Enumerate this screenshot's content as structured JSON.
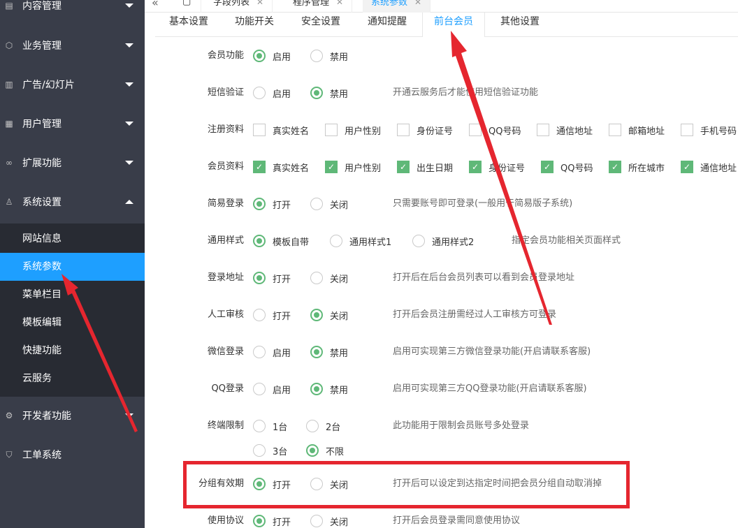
{
  "sidebar": {
    "items": [
      {
        "label": "内容管理",
        "icon": "content-icon"
      },
      {
        "label": "业务管理",
        "icon": "cube-icon"
      },
      {
        "label": "广告/幻灯片",
        "icon": "slides-icon"
      },
      {
        "label": "用户管理",
        "icon": "grid-icon"
      },
      {
        "label": "扩展功能",
        "icon": "infinity-icon"
      },
      {
        "label": "系统设置",
        "icon": "user-settings-icon"
      },
      {
        "label": "开发者功能",
        "icon": "gear-icon"
      },
      {
        "label": "工单系统",
        "icon": "shield-icon"
      }
    ],
    "submenu": [
      "网站信息",
      "系统参数",
      "菜单栏目",
      "模板编辑",
      "快捷功能",
      "云服务"
    ]
  },
  "top_tabs": [
    {
      "label": "字段列表"
    },
    {
      "label": "程序管理"
    },
    {
      "label": "系统参数"
    }
  ],
  "setting_tabs": [
    "基本设置",
    "功能开关",
    "安全设置",
    "通知提醒",
    "前台会员",
    "其他设置"
  ],
  "form": {
    "member_function": {
      "label": "会员功能",
      "options": [
        "启用",
        "禁用"
      ]
    },
    "sms_verify": {
      "label": "短信验证",
      "options": [
        "启用",
        "禁用"
      ],
      "tip": "开通云服务后才能使用短信验证功能"
    },
    "register_info": {
      "label": "注册资料",
      "options": [
        "真实姓名",
        "用户性别",
        "身份证号",
        "QQ号码",
        "通信地址",
        "邮箱地址",
        "手机号码"
      ]
    },
    "member_info": {
      "label": "会员资料",
      "options": [
        "真实姓名",
        "用户性别",
        "出生日期",
        "身份证号",
        "QQ号码",
        "所在城市",
        "通信地址"
      ]
    },
    "simple_login": {
      "label": "简易登录",
      "options": [
        "打开",
        "关闭"
      ],
      "tip": "只需要账号即可登录(一般用于简易版子系统)"
    },
    "common_style": {
      "label": "通用样式",
      "options": [
        "模板自带",
        "通用样式1",
        "通用样式2"
      ],
      "tip": "指定会员功能相关页面样式"
    },
    "login_address": {
      "label": "登录地址",
      "options": [
        "打开",
        "关闭"
      ],
      "tip": "打开后在后台会员列表可以看到会员登录地址"
    },
    "manual_review": {
      "label": "人工审核",
      "options": [
        "打开",
        "关闭"
      ],
      "tip": "打开后会员注册需经过人工审核方可登录"
    },
    "wechat_login": {
      "label": "微信登录",
      "options": [
        "启用",
        "禁用"
      ],
      "tip": "启用可实现第三方微信登录功能(开启请联系客服)"
    },
    "qq_login": {
      "label": "QQ登录",
      "options": [
        "启用",
        "禁用"
      ],
      "tip": "启用可实现第三方QQ登录功能(开启请联系客服)"
    },
    "device_limit": {
      "label": "终端限制",
      "options": [
        "1台",
        "2台",
        "3台",
        "不限"
      ],
      "tip": "此功能用于限制会员账号多处登录"
    },
    "group_validity": {
      "label": "分组有效期",
      "options": [
        "打开",
        "关闭"
      ],
      "tip": "打开后可以设定到达指定时间把会员分组自动取消掉"
    },
    "use_agreement": {
      "label": "使用协议",
      "options": [
        "打开",
        "关闭"
      ],
      "tip": "打开后会员登录需同意使用协议"
    }
  },
  "colors": {
    "sidebar_bg": "#393d49",
    "submenu_bg": "#282b33",
    "active_blue": "#1e9fff",
    "checked_green": "#5fb878",
    "annotation_red": "#e5262f"
  }
}
